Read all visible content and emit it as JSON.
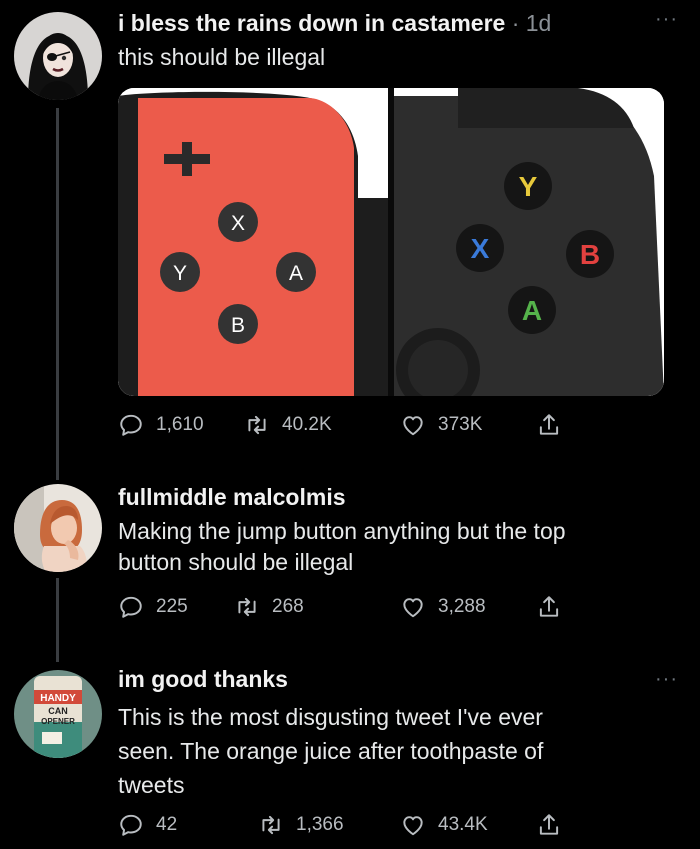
{
  "tweets": [
    {
      "author": "i bless the rains down in castamere",
      "time": "· 1d",
      "more": "···",
      "text": "this should be illegal",
      "media": {
        "left": {
          "buttons": [
            "X",
            "Y",
            "A",
            "B"
          ],
          "color": "#ec5b4b"
        },
        "right": {
          "buttons": [
            "Y",
            "X",
            "B",
            "A"
          ],
          "colors": {
            "Y": "#e7c93b",
            "X": "#3a7ad9",
            "B": "#e2413f",
            "A": "#55b34b"
          }
        }
      },
      "replies": "1,610",
      "retweets": "40.2K",
      "likes": "373K"
    },
    {
      "author": "fullmiddle malcolmis",
      "text_lines": [
        "Making the jump button anything but the top",
        "button should be illegal"
      ],
      "replies": "225",
      "retweets": "268",
      "likes": "3,288"
    },
    {
      "author": "im good thanks",
      "more": "···",
      "avatar_text": [
        "HANDY",
        "CAN",
        "OPENER"
      ],
      "text_lines": [
        "This is the most disgusting tweet I've ever",
        "seen. The orange juice after toothpaste of",
        "tweets"
      ],
      "replies": "42",
      "retweets": "1,366",
      "likes": "43.4K"
    }
  ],
  "icons": {
    "reply": "reply-icon",
    "retweet": "retweet-icon",
    "like": "like-icon",
    "share": "share-icon"
  }
}
